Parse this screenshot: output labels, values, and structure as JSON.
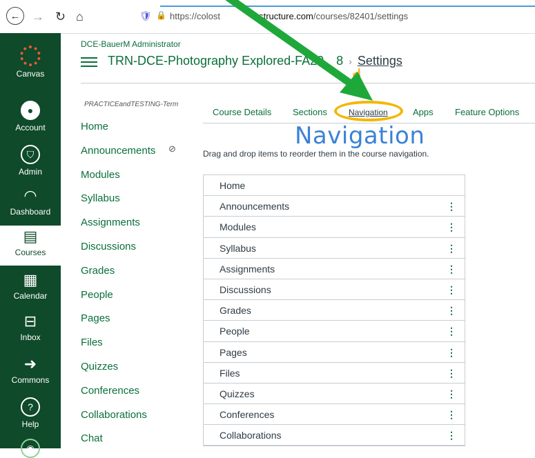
{
  "browser": {
    "url_prefix": "https://colost",
    "url_host": "instructure.com",
    "url_path": "/courses/82401/settings"
  },
  "global_nav": {
    "items": [
      {
        "label": "Canvas",
        "icon": "canvas-logo-icon"
      },
      {
        "label": "Account",
        "icon": "account-icon"
      },
      {
        "label": "Admin",
        "icon": "admin-shield-icon"
      },
      {
        "label": "Dashboard",
        "icon": "dashboard-icon"
      },
      {
        "label": "Courses",
        "icon": "courses-book-icon"
      },
      {
        "label": "Calendar",
        "icon": "calendar-icon"
      },
      {
        "label": "Inbox",
        "icon": "inbox-icon"
      },
      {
        "label": "Commons",
        "icon": "commons-icon"
      },
      {
        "label": "Help",
        "icon": "help-icon"
      }
    ]
  },
  "header": {
    "admin_label": "DCE-BauerM Administrator",
    "course_name": "TRN-DCE-Photography Explored-FA20",
    "course_suffix": "8",
    "current_page": "Settings"
  },
  "course_nav": {
    "term": "PRACTICEandTESTING-Term",
    "items": [
      "Home",
      "Announcements",
      "Modules",
      "Syllabus",
      "Assignments",
      "Discussions",
      "Grades",
      "People",
      "Pages",
      "Files",
      "Quizzes",
      "Conferences",
      "Collaborations",
      "Chat"
    ]
  },
  "tabs": [
    "Course Details",
    "Sections",
    "Navigation",
    "Apps",
    "Feature Options"
  ],
  "annotation_title": "Navigation",
  "instructions": "Drag and drop items to reorder them in the course navigation.",
  "nav_list": [
    "Home",
    "Announcements",
    "Modules",
    "Syllabus",
    "Assignments",
    "Discussions",
    "Grades",
    "People",
    "Pages",
    "Files",
    "Quizzes",
    "Conferences",
    "Collaborations"
  ],
  "colors": {
    "accent": "#0a6e3a",
    "sidebar": "#0f4a2a",
    "highlight": "#f2b705",
    "arrow": "#1fa83a",
    "annotation": "#3b82d6"
  }
}
